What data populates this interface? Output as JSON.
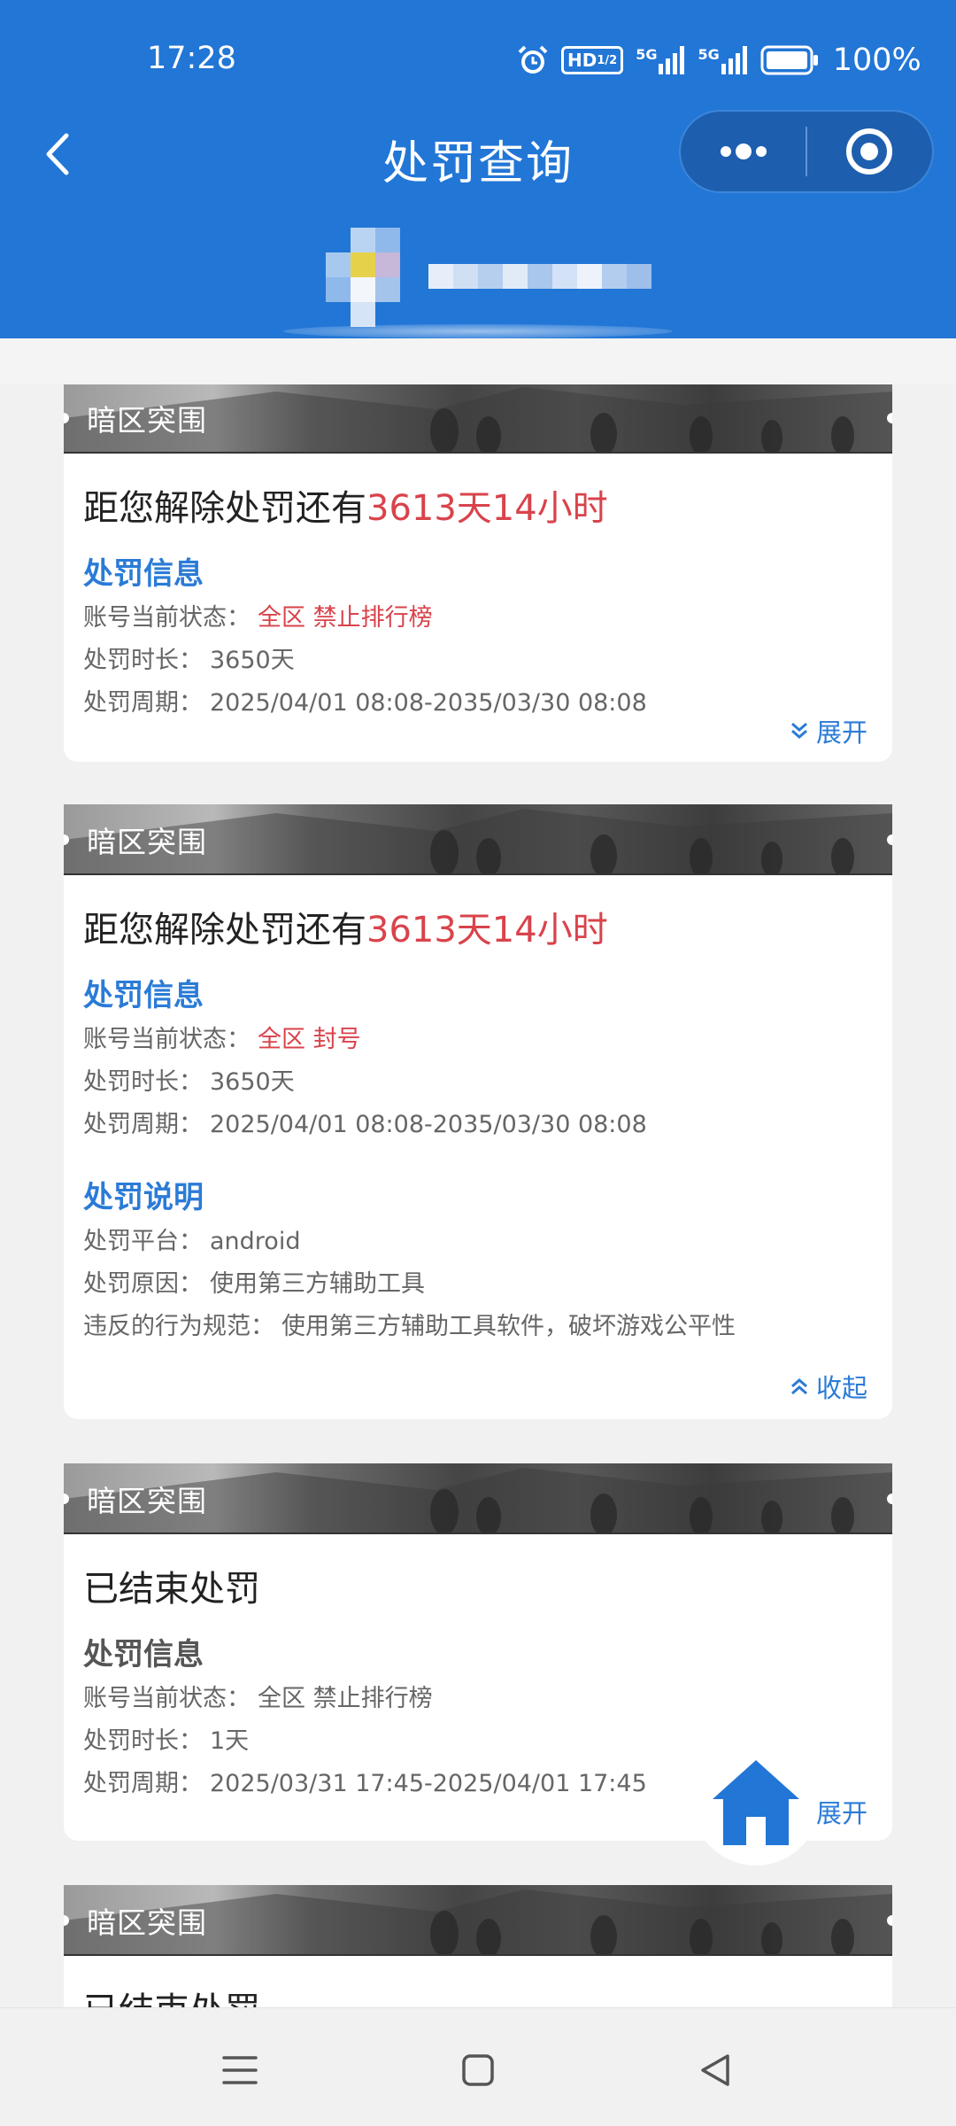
{
  "status_bar": {
    "time": "17:28",
    "hd_label": "HD",
    "net1": "5G",
    "net2": "5G",
    "battery": "100%"
  },
  "nav": {
    "title": "处罚查询",
    "back_icon": "chevron-left-icon",
    "more_icon": "more-dots-icon",
    "close_icon": "target-close-icon"
  },
  "colors": {
    "header_blue": "#2276d6",
    "accent_blue": "#2b7bd7",
    "alert_red": "#d9434b"
  },
  "cards": [
    {
      "game": "暗区突围",
      "headline_prefix": "距您解除处罚还有",
      "headline_remain": "3613天14小时",
      "info_title": "处罚信息",
      "rows": [
        {
          "label": "账号当前状态：",
          "value": "全区 禁止排行榜"
        },
        {
          "label": "处罚时长：",
          "value": "3650天"
        },
        {
          "label": "处罚周期：",
          "value": "2025/04/01 08:08-2035/03/30 08:08"
        }
      ],
      "toggle": "展开"
    },
    {
      "game": "暗区突围",
      "headline_prefix": "距您解除处罚还有",
      "headline_remain": "3613天14小时",
      "info_title": "处罚信息",
      "rows": [
        {
          "label": "账号当前状态：",
          "value": "全区 封号"
        },
        {
          "label": "处罚时长：",
          "value": "3650天"
        },
        {
          "label": "处罚周期：",
          "value": "2025/04/01 08:08-2035/03/30 08:08"
        }
      ],
      "explain_title": "处罚说明",
      "explain_rows": [
        {
          "label": "处罚平台：",
          "value": "android"
        },
        {
          "label": "处罚原因：",
          "value": "使用第三方辅助工具"
        },
        {
          "label": "违反的行为规范：",
          "value": "使用第三方辅助工具软件，破坏游戏公平性"
        }
      ],
      "toggle": "收起"
    },
    {
      "game": "暗区突围",
      "headline": "已结束处罚",
      "info_title": "处罚信息",
      "rows": [
        {
          "label": "账号当前状态：",
          "value": "全区 禁止排行榜"
        },
        {
          "label": "处罚时长：",
          "value": "1天"
        },
        {
          "label": "处罚周期：",
          "value": "2025/03/31 17:45-2025/04/01 17:45"
        }
      ],
      "toggle": "展开"
    },
    {
      "game": "暗区突围",
      "headline": "已结束处罚"
    }
  ],
  "fab": {
    "icon": "home-icon"
  },
  "system_nav": {
    "menu_icon": "menu-icon",
    "home_icon": "square-home-icon",
    "back_icon": "triangle-back-icon"
  }
}
